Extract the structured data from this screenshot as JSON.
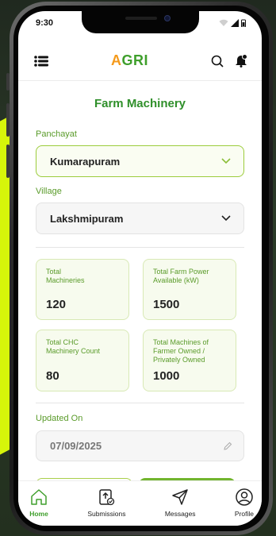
{
  "status": {
    "time": "9:30"
  },
  "app": {
    "logo_a": "A",
    "logo_rest": "GRI"
  },
  "page": {
    "title": "Farm Machinery"
  },
  "panchayat": {
    "label": "Panchayat",
    "value": "Kumarapuram"
  },
  "village": {
    "label": "Village",
    "value": "Lakshmipuram"
  },
  "stats": [
    {
      "label": "Total Machineries",
      "value": "120"
    },
    {
      "label": "Total Farm Power Available (kW)",
      "value": "1500"
    },
    {
      "label": "Total CHC Machinery Count",
      "value": "80"
    },
    {
      "label": "Total Machines of Farmer Owned / Privately Owned",
      "value": "1000"
    }
  ],
  "updated": {
    "label": "Updated On",
    "value": "07/09/2025"
  },
  "nav": {
    "home": "Home",
    "submissions": "Submissions",
    "messages": "Messages",
    "profile": "Profile"
  },
  "colors": {
    "accent": "#3f9f2c",
    "logo_orange": "#f59a1b",
    "border_green": "#9ccc3c"
  }
}
